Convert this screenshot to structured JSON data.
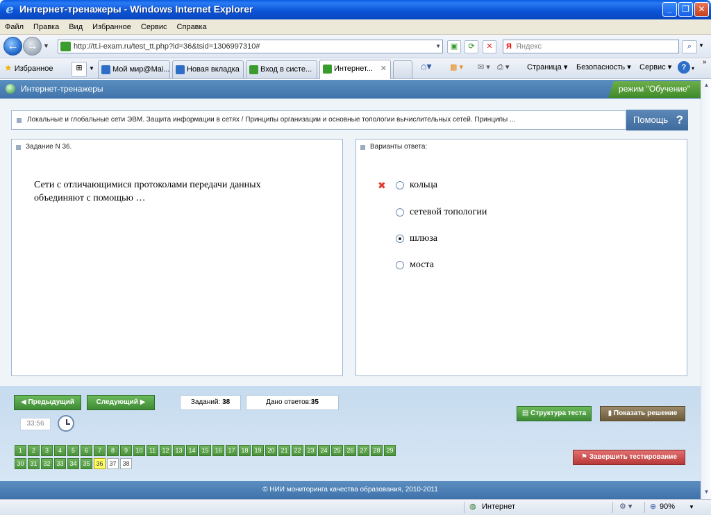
{
  "window": {
    "title": "Интернет-тренажеры - Windows Internet Explorer"
  },
  "menu": [
    "Файл",
    "Правка",
    "Вид",
    "Избранное",
    "Сервис",
    "Справка"
  ],
  "address": {
    "url": "http://tt.i-exam.ru/test_tt.php?id=36&tsid=1306997310#"
  },
  "search": {
    "placeholder": "Яндекс",
    "logo": "Я"
  },
  "favorites": {
    "label": "Избранное"
  },
  "tabs": [
    {
      "label": "Мой мир@Mai..."
    },
    {
      "label": "Новая вкладка"
    },
    {
      "label": "Вход в систе..."
    },
    {
      "label": "Интернет..."
    }
  ],
  "commands": {
    "page": "Страница",
    "security": "Безопасность",
    "service": "Сервис"
  },
  "app": {
    "name": "Интернет-тренажеры",
    "mode": "режим \"Обучение\"",
    "breadcrumb": "Локальные и глобальные сети ЭВМ. Защита информации в сетях / Принципы организации и основные топологии вычислительных сетей. Принципы ...",
    "help": "Помощь",
    "help_q": "?"
  },
  "task": {
    "header": "Задание N 36.",
    "question": "Сети с отличающимися протоколами передачи данных объединяют с помощью …"
  },
  "answers": {
    "header": "Варианты ответа:",
    "options": [
      "кольца",
      "сетевой топологии",
      "шлюза",
      "моста"
    ],
    "selected_index": 2,
    "wrong_index": 0
  },
  "nav": {
    "prev": "Предыдущий",
    "next": "Следующий",
    "tasks_label": "Заданий:",
    "tasks_count": "38",
    "answered_label": "Дано ответов:",
    "answered_count": "35",
    "structure": "Структура теста",
    "show_solution": "Показать решение",
    "finish": "Завершить тестирование",
    "timer": "33:56"
  },
  "numbers_row1": [
    "1",
    "2",
    "3",
    "4",
    "5",
    "6",
    "7",
    "8",
    "9",
    "10",
    "11",
    "12",
    "13",
    "14",
    "15",
    "16",
    "17",
    "18",
    "19",
    "20",
    "21",
    "22",
    "23",
    "24",
    "25",
    "26",
    "27",
    "28",
    "29"
  ],
  "numbers_row2": [
    "30",
    "31",
    "32",
    "33",
    "34",
    "35",
    "36",
    "37",
    "38"
  ],
  "current_number": "36",
  "unanswered_numbers": [
    "37",
    "38"
  ],
  "footer": "© НИИ мониторинга качества образования, 2010-2011",
  "status": {
    "zone": "Интернет",
    "zoom": "90%"
  },
  "colors": {
    "accent": "#3f74ab",
    "green": "#4a953b",
    "wrong": "#e03a2c",
    "finish": "#c94848"
  }
}
